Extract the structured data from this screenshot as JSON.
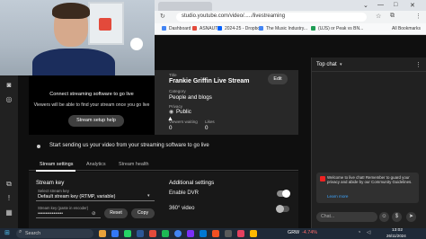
{
  "browser": {
    "url": "studio.youtube.com/video/...../livestreaming",
    "bookmarks": [
      "Dashboard",
      "ASNAUT",
      "2024-25 - Dropbox",
      "The Music Industry...",
      "(UJS) or Peak vs BN...",
      "All Bookmarks"
    ]
  },
  "preview": {
    "line1": "Connect streaming software to go live",
    "line2": "Viewers will be able to find your stream once you go live",
    "setup_help": "Stream setup help"
  },
  "info": {
    "title_label": "Title",
    "title": "Frankie Griffin Live Stream",
    "category_label": "Category",
    "category": "People and blogs",
    "privacy_label": "Privacy",
    "privacy": "Public",
    "viewers_label": "Viewers waiting",
    "viewers": "0",
    "likes_label": "Likes",
    "likes": "0",
    "edit": "Edit"
  },
  "banner": {
    "text": "Start sending us your video from your streaming software to go live"
  },
  "tabs": [
    "Stream settings",
    "Analytics",
    "Stream health"
  ],
  "settings": {
    "stream_key_heading": "Stream key",
    "select_key_label": "Select stream key",
    "select_key_value": "Default stream key (RTMP, variable)",
    "key_field_label": "Stream key (paste in encoder)",
    "key_masked": "••••••••••••••••",
    "reset": "Reset",
    "copy": "Copy",
    "additional_heading": "Additional settings",
    "dvr": "Enable DVR",
    "video360": "360° video"
  },
  "chat": {
    "header": "Top chat",
    "welcome": "Welcome to live chat! Remember to guard your privacy and abide by our Community Guidelines.",
    "learn_more": "Learn more",
    "input_placeholder": "Chat..."
  },
  "taskbar": {
    "search": "Search",
    "ticker": "GRW",
    "ticker_change": "-4.74%",
    "time": "13:02",
    "date": "26/11/2024"
  }
}
